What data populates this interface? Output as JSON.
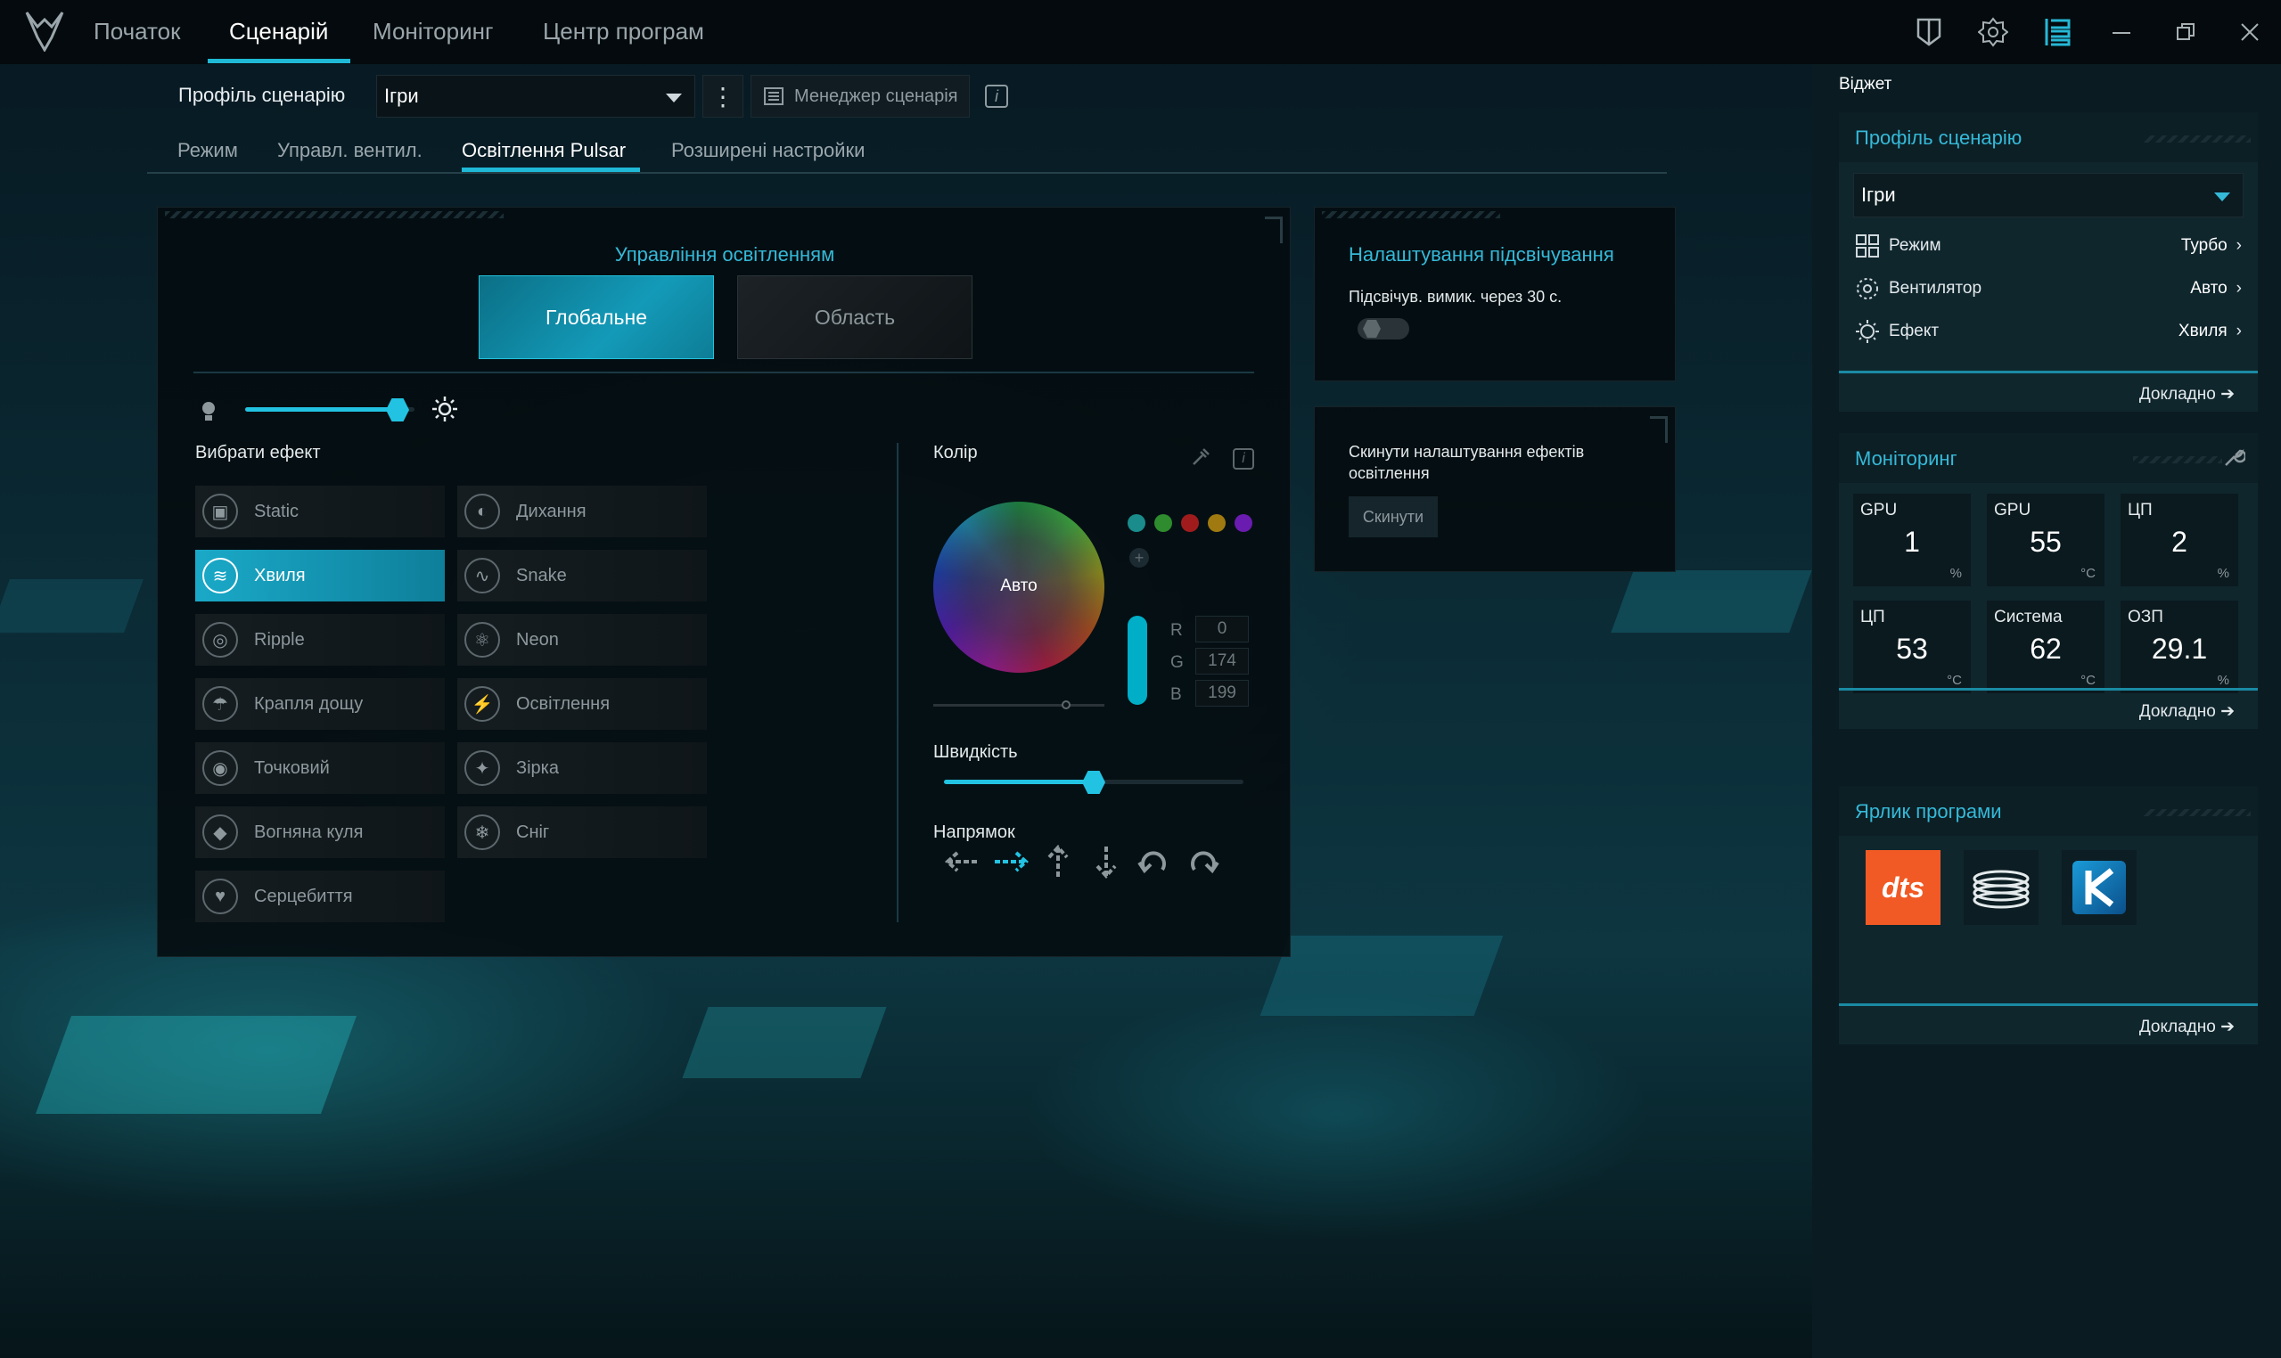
{
  "nav": {
    "items": [
      "Початок",
      "Сценарій",
      "Моніторинг",
      "Центр програм"
    ],
    "active": "Сценарій"
  },
  "profile": {
    "label": "Профіль сценарію",
    "value": "Ігри",
    "manager": "Менеджер сценарія"
  },
  "subtabs": [
    "Режим",
    "Управл. вентил.",
    "Освітлення Pulsar",
    "Розширені настройки"
  ],
  "lighting": {
    "title": "Управління освітленням",
    "global": "Глобальне",
    "area": "Область",
    "brightness": 0.9,
    "effects_title": "Вибрати ефект",
    "effects": [
      "Static",
      "Дихання",
      "Хвиля",
      "Snake",
      "Ripple",
      "Neon",
      "Крапля дощу",
      "Освітлення",
      "Точковий",
      "Зірка",
      "Вогняна куля",
      "Сніг",
      "Серцебиття"
    ],
    "active_effect": "Хвиля",
    "color_title": "Колір",
    "wheel_label": "Авто",
    "presets": [
      "#1a8c8c",
      "#2e8b2e",
      "#a01c1c",
      "#a07a10",
      "#6a1cb0"
    ],
    "rgb": {
      "r_label": "R",
      "g_label": "G",
      "b_label": "B",
      "r": "0",
      "g": "174",
      "b": "199"
    },
    "speed_title": "Швидкість",
    "speed": 0.5,
    "direction_title": "Напрямок"
  },
  "backlight": {
    "title": "Налаштування підсвічування",
    "text": "Підсвічув. вимик. через 30 с."
  },
  "reset": {
    "text": "Скинути налаштування ефектів освітлення",
    "button": "Скинути"
  },
  "widget": {
    "title": "Віджет",
    "profile": {
      "title": "Профіль сценарію",
      "value": "Ігри",
      "rows": [
        {
          "k": "Режим",
          "v": "Турбо"
        },
        {
          "k": "Вентилятор",
          "v": "Авто"
        },
        {
          "k": "Ефект",
          "v": "Хвиля"
        }
      ],
      "more": "Докладно"
    },
    "monitoring": {
      "title": "Моніторинг",
      "cells": [
        {
          "t": "GPU",
          "n": "1",
          "u": "%"
        },
        {
          "t": "GPU",
          "n": "55",
          "u": "°C"
        },
        {
          "t": "ЦП",
          "n": "2",
          "u": "%"
        },
        {
          "t": "ЦП",
          "n": "53",
          "u": "°C"
        },
        {
          "t": "Система",
          "n": "62",
          "u": "°C"
        },
        {
          "t": "ОЗП",
          "n": "29.1",
          "u": "%"
        }
      ],
      "more": "Докладно"
    },
    "shortcuts": {
      "title": "Ярлик програми",
      "apps": [
        "dts"
      ],
      "more": "Докладно"
    }
  }
}
